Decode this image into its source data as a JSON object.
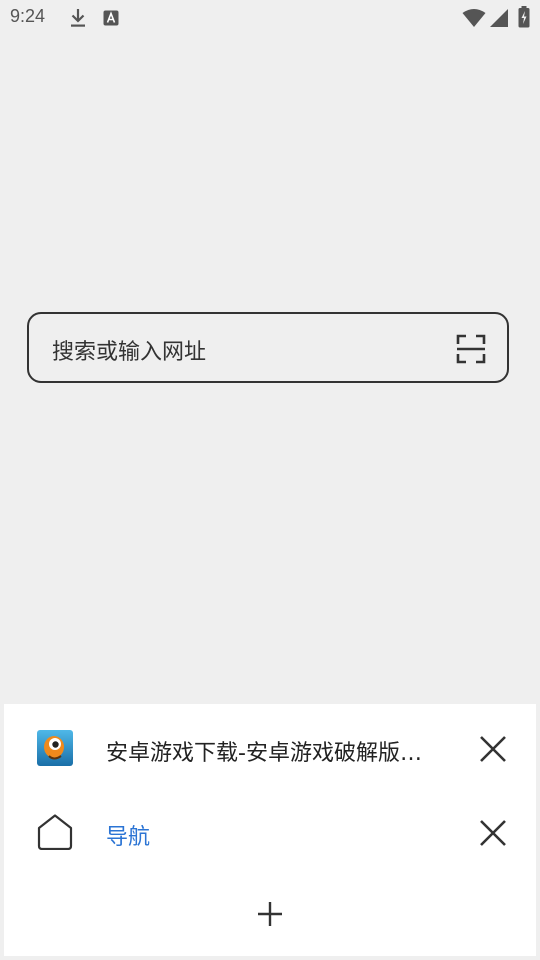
{
  "status_bar": {
    "time": "9:24",
    "icons": [
      "download-icon",
      "a-notification-icon",
      "wifi-icon",
      "signal-icon",
      "battery-charging-icon"
    ]
  },
  "search": {
    "placeholder": "搜索或输入网址",
    "scan_icon": "scan-icon"
  },
  "tabs": [
    {
      "title": "安卓游戏下载-安卓游戏破解版…",
      "favicon": "bird-app-icon",
      "close_icon": "close-icon"
    },
    {
      "title": "导航",
      "favicon": "home-icon",
      "close_icon": "close-icon",
      "color": "#2b74d4"
    }
  ],
  "new_tab_icon": "plus-icon",
  "colors": {
    "background": "#efefef",
    "sheet": "#ffffff",
    "link": "#2b74d4"
  }
}
